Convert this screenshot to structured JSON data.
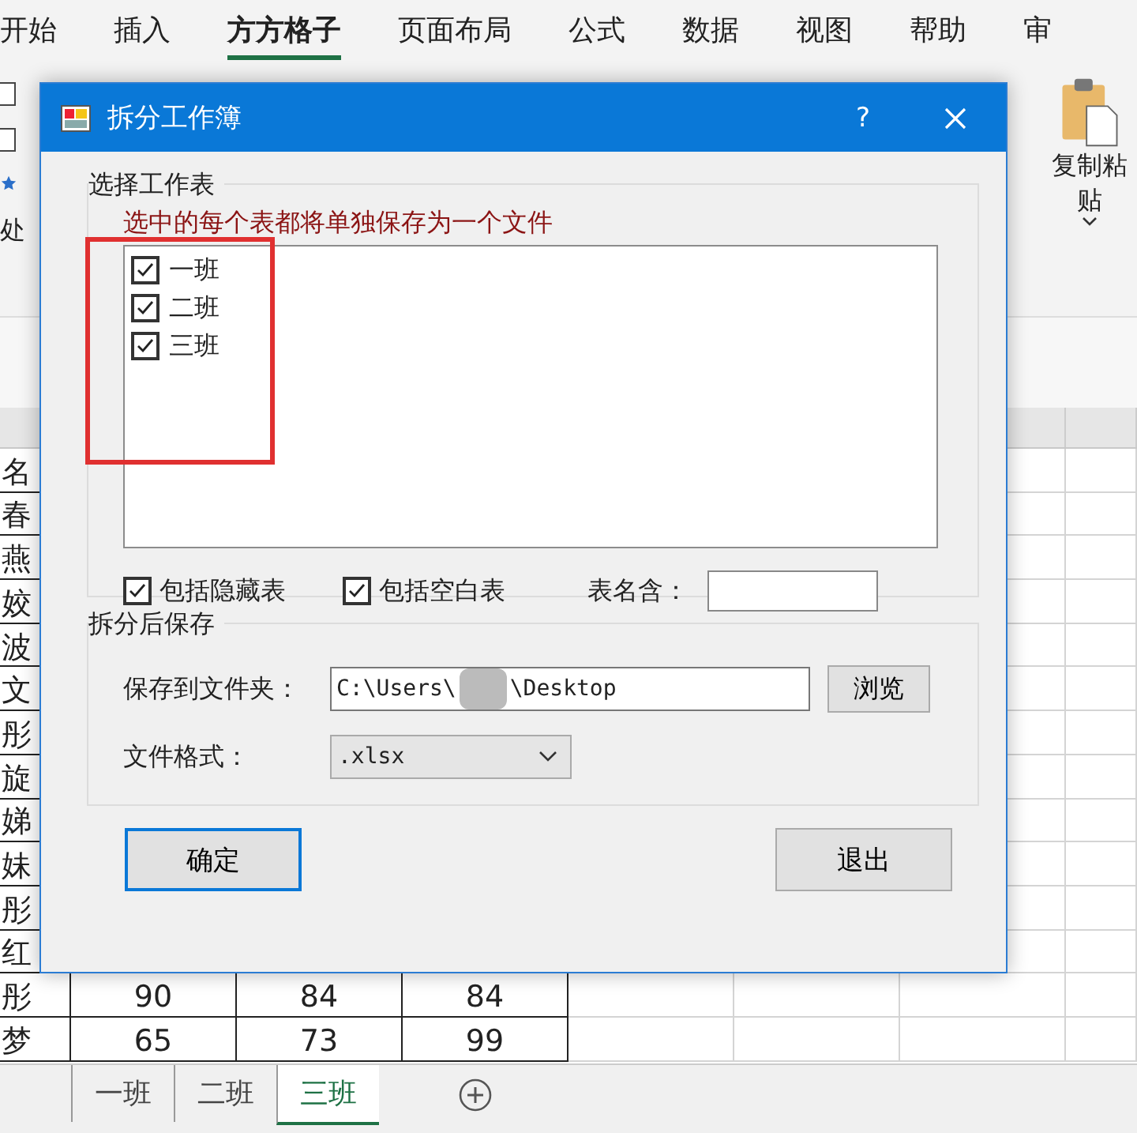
{
  "ribbon": {
    "tabs": [
      {
        "label": "开始",
        "selected": false
      },
      {
        "label": "插入",
        "selected": false
      },
      {
        "label": "方方格子",
        "selected": true
      },
      {
        "label": "页面布局",
        "selected": false
      },
      {
        "label": "公式",
        "selected": false
      },
      {
        "label": "数据",
        "selected": false
      },
      {
        "label": "视图",
        "selected": false
      },
      {
        "label": "帮助",
        "selected": false
      },
      {
        "label": "审",
        "selected": false
      }
    ],
    "left_controls": [
      {
        "kind": "checkbox",
        "checked": false
      },
      {
        "kind": "checkbox",
        "checked": false
      },
      {
        "kind": "star"
      }
    ],
    "group_label": "处",
    "paste_button": {
      "label": "复制粘贴"
    }
  },
  "sheet": {
    "rows": [
      {
        "cells": [
          "名"
        ]
      },
      {
        "cells": [
          "春"
        ]
      },
      {
        "cells": [
          "燕"
        ]
      },
      {
        "cells": [
          "姣"
        ]
      },
      {
        "cells": [
          "波"
        ]
      },
      {
        "cells": [
          "文"
        ]
      },
      {
        "cells": [
          "彤"
        ]
      },
      {
        "cells": [
          "旋"
        ]
      },
      {
        "cells": [
          "娣"
        ]
      },
      {
        "cells": [
          "妹"
        ]
      },
      {
        "cells": [
          "彤"
        ]
      },
      {
        "cells": [
          "红"
        ]
      },
      {
        "cells": [
          "彤",
          "90",
          "84",
          "84"
        ]
      },
      {
        "cells": [
          "梦",
          "65",
          "73",
          "99"
        ]
      }
    ],
    "tabs": [
      {
        "label": "一班",
        "selected": false
      },
      {
        "label": "二班",
        "selected": false
      },
      {
        "label": "三班",
        "selected": true
      }
    ]
  },
  "dialog": {
    "title": "拆分工作簿",
    "help": "?",
    "select_group": {
      "legend": "选择工作表",
      "hint": "选中的每个表都将单独保存为一个文件",
      "sheets": [
        {
          "label": "一班",
          "checked": true
        },
        {
          "label": "二班",
          "checked": true
        },
        {
          "label": "三班",
          "checked": true
        }
      ],
      "options": [
        {
          "label": "包括隐藏表",
          "checked": true
        },
        {
          "label": "包括空白表",
          "checked": true
        }
      ],
      "name_filter": {
        "label": "表名含："
      }
    },
    "save_group": {
      "legend": "拆分后保存",
      "folder_label": "保存到文件夹：",
      "folder_value_start": "C:\\Users\\",
      "folder_redacted": true,
      "folder_value_end": "\\Desktop",
      "browse": "浏览",
      "format_label": "文件格式：",
      "format_value": ".xlsx"
    },
    "highlight": true,
    "buttons": [
      {
        "label": "确定",
        "default": true
      },
      {
        "label": "退出",
        "default": false
      }
    ]
  }
}
